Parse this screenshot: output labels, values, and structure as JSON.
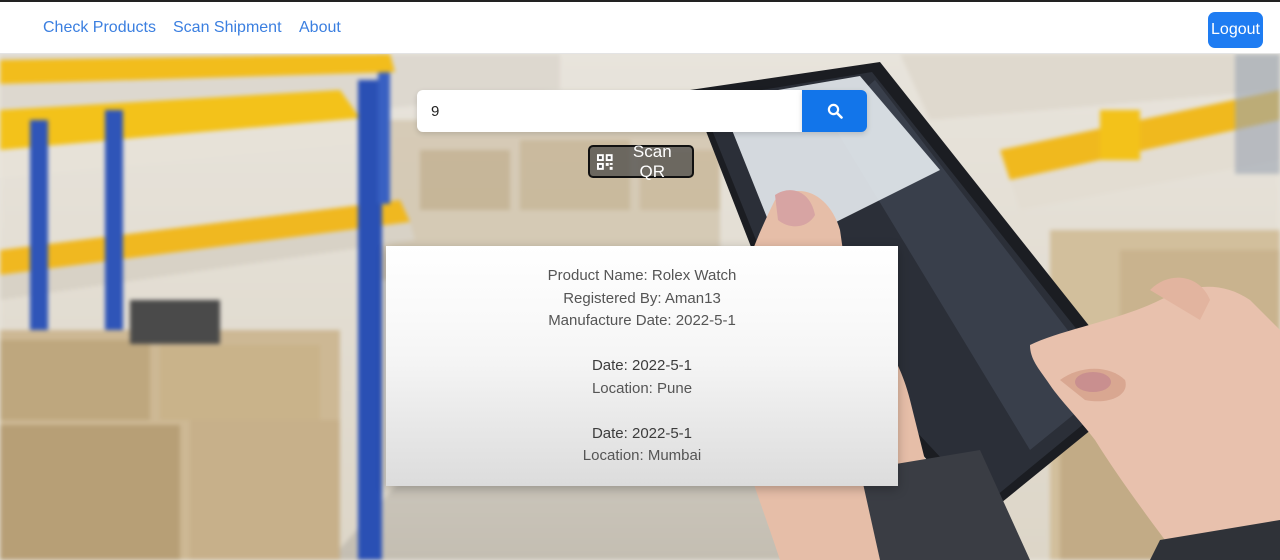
{
  "nav": {
    "links": [
      "Check Products",
      "Scan Shipment",
      "About"
    ],
    "logout_label": "Logout"
  },
  "search": {
    "value": "9",
    "icon": "search-icon"
  },
  "scan": {
    "label": "Scan QR",
    "icon": "qr-code-icon"
  },
  "product": {
    "name": "Product Name: Rolex Watch",
    "registered_by": "Registered By: Aman13",
    "manufacture_date": "Manufacture Date: 2022-5-1",
    "history": [
      {
        "date": "Date: 2022-5-1",
        "location": "Location: Pune"
      },
      {
        "date": "Date: 2022-5-1",
        "location": "Location: Mumbai"
      }
    ]
  },
  "colors": {
    "accent": "#1275ea",
    "link": "#3b7fe0"
  }
}
